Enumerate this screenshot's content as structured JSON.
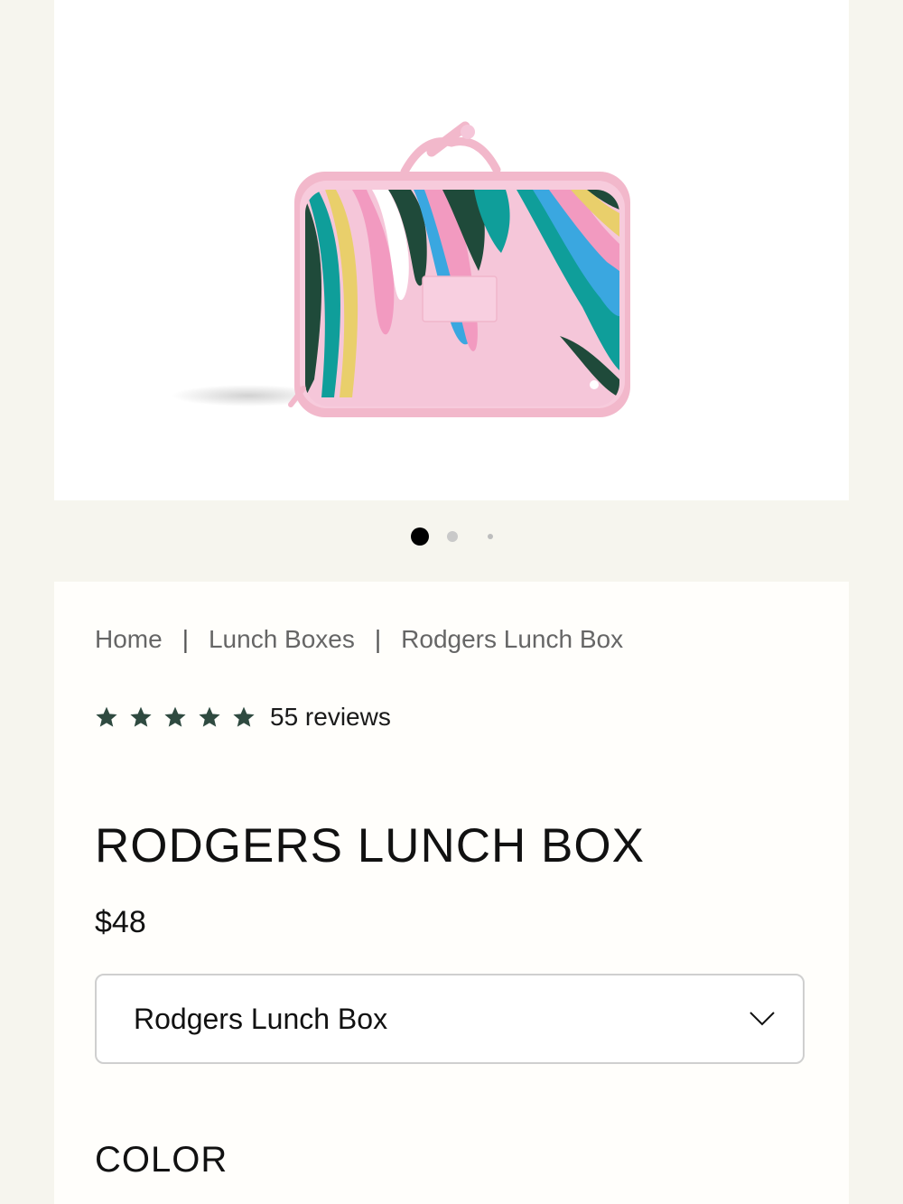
{
  "product_image": {
    "alt": "Rodgers Lunch Box",
    "colors": {
      "pink": "#f5c6d9",
      "trim": "#f2b8cb",
      "teal": "#0f9e9a",
      "dark_green": "#1f4a3a",
      "yellow": "#e9cf6b",
      "blue": "#3aa7e0",
      "hot_pink": "#f29ac0"
    }
  },
  "carousel": {
    "slide_count": 3,
    "active_index": 0
  },
  "breadcrumb": {
    "items": [
      "Home",
      "Lunch Boxes",
      "Rodgers Lunch Box"
    ],
    "separator": "|"
  },
  "rating": {
    "stars": 5,
    "reviews_text": "55 reviews",
    "star_color": "#2f4a40"
  },
  "product": {
    "title": "RODGERS LUNCH BOX",
    "price": "$48"
  },
  "variant_select": {
    "selected": "Rodgers Lunch Box",
    "icon": "chevron-down-icon"
  },
  "color_section": {
    "label": "COLOR"
  }
}
